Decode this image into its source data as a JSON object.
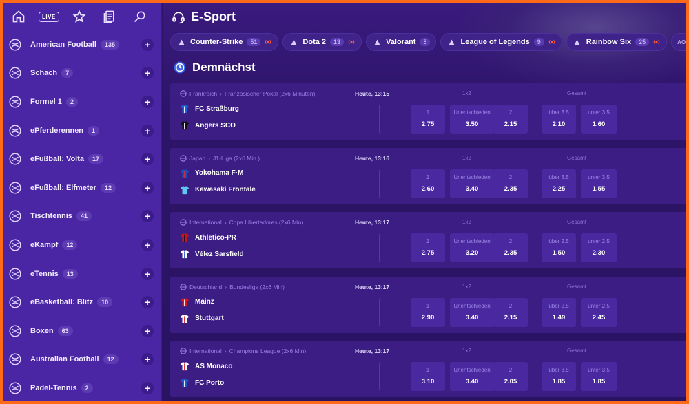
{
  "page_title": "E-Sport",
  "section_title": "Demnächst",
  "topbar": {
    "live_label": "LIVE"
  },
  "sidebar": {
    "items": [
      {
        "label": "American Football",
        "count": "135",
        "icon": "american-football-icon"
      },
      {
        "label": "Schach",
        "count": "7",
        "icon": "chess-knight-icon"
      },
      {
        "label": "Formel 1",
        "count": "2",
        "icon": "checkered-flag-icon"
      },
      {
        "label": "ePferderennen",
        "count": "1",
        "icon": "horse-racing-icon"
      },
      {
        "label": "eFußball: Volta",
        "count": "17",
        "icon": "soccer-ball-volta-icon"
      },
      {
        "label": "eFußball: Elfmeter",
        "count": "12",
        "icon": "soccer-ball-penalty-icon"
      },
      {
        "label": "Tischtennis",
        "count": "41",
        "icon": "table-tennis-icon"
      },
      {
        "label": "eKampf",
        "count": "12",
        "icon": "fist-icon"
      },
      {
        "label": "eTennis",
        "count": "13",
        "icon": "tennis-icon"
      },
      {
        "label": "eBasketball: Blitz",
        "count": "10",
        "icon": "basketball-blitz-icon"
      },
      {
        "label": "Boxen",
        "count": "63",
        "icon": "boxing-glove-icon"
      },
      {
        "label": "Australian Football",
        "count": "12",
        "icon": "australian-football-icon"
      },
      {
        "label": "Padel-Tennis",
        "count": "2",
        "icon": "padel-icon"
      }
    ]
  },
  "chips": [
    {
      "label": "Counter-Strike",
      "count": "51",
      "live": true
    },
    {
      "label": "Dota 2",
      "count": "13",
      "live": true
    },
    {
      "label": "Valorant",
      "count": "8",
      "live": false
    },
    {
      "label": "League of Legends",
      "count": "9",
      "live": true
    },
    {
      "label": "Rainbow Six",
      "count": "25",
      "live": true
    },
    {
      "label": "Arena of Valor",
      "count": "",
      "live": false,
      "prefix": "AOV"
    }
  ],
  "matches": [
    {
      "country": "Frankreich",
      "league": "Französischer Pokal (2x6 Minuten)",
      "time": "Heute, 13:15",
      "home": "FC Straßburg",
      "away": "Angers SCO",
      "market1": "1x2",
      "market2": "Gesamt",
      "odds": [
        {
          "label": "1",
          "value": "2.75"
        },
        {
          "label": "Unentschieden",
          "value": "3.50"
        },
        {
          "label": "2",
          "value": "2.15"
        },
        {
          "label": "über 3.5",
          "value": "2.10"
        },
        {
          "label": "unter 3.5",
          "value": "1.60"
        }
      ],
      "home_colors": [
        "#1e5bd6",
        "#ffffff"
      ],
      "away_colors": [
        "#111111",
        "#ffffff"
      ]
    },
    {
      "country": "Japan",
      "league": "J1-Liga (2x6 Min.)",
      "time": "Heute, 13:16",
      "home": "Yokohama F·M",
      "away": "Kawasaki Frontale",
      "market1": "1x2",
      "market2": "Gesamt",
      "odds": [
        {
          "label": "1",
          "value": "2.60"
        },
        {
          "label": "Unentschieden",
          "value": "3.40"
        },
        {
          "label": "2",
          "value": "2.35"
        },
        {
          "label": "über 3.5",
          "value": "2.25"
        },
        {
          "label": "unter 3.5",
          "value": "1.55"
        }
      ],
      "home_colors": [
        "#1d4fc4",
        "#e02b2b"
      ],
      "away_colors": [
        "#5fc8f0",
        "#5fc8f0"
      ]
    },
    {
      "country": "International",
      "league": "Copa Libertadores (2x6 Min)",
      "time": "Heute, 13:17",
      "home": "Athletico-PR",
      "away": "Vélez Sarsfield",
      "market1": "1x2",
      "market2": "Gesamt",
      "odds": [
        {
          "label": "1",
          "value": "2.75"
        },
        {
          "label": "Unentschieden",
          "value": "3.20"
        },
        {
          "label": "2",
          "value": "2.35"
        },
        {
          "label": "über 2.5",
          "value": "1.50"
        },
        {
          "label": "unter 2.5",
          "value": "2.30"
        }
      ],
      "home_colors": [
        "#c4161c",
        "#111111"
      ],
      "away_colors": [
        "#ffffff",
        "#1e56c8"
      ]
    },
    {
      "country": "Deutschland",
      "league": "Bundesliga (2x6 Min)",
      "time": "Heute, 13:17",
      "home": "Mainz",
      "away": "Stuttgart",
      "market1": "1x2",
      "market2": "Gesamt",
      "odds": [
        {
          "label": "1",
          "value": "2.90"
        },
        {
          "label": "Unentschieden",
          "value": "3.40"
        },
        {
          "label": "2",
          "value": "2.15"
        },
        {
          "label": "über 2.5",
          "value": "1.49"
        },
        {
          "label": "unter 2.5",
          "value": "2.45"
        }
      ],
      "home_colors": [
        "#d8141e",
        "#ffffff"
      ],
      "away_colors": [
        "#ffffff",
        "#d8141e"
      ]
    },
    {
      "country": "International",
      "league": "Champions League (2x6 Min)",
      "time": "Heute, 13:17",
      "home": "AS Monaco",
      "away": "FC Porto",
      "market1": "1x2",
      "market2": "Gesamt",
      "odds": [
        {
          "label": "1",
          "value": "3.10"
        },
        {
          "label": "Unentschieden",
          "value": "3.40"
        },
        {
          "label": "2",
          "value": "2.05"
        },
        {
          "label": "über 3.5",
          "value": "1.85"
        },
        {
          "label": "unter 3.5",
          "value": "1.85"
        }
      ],
      "home_colors": [
        "#ffffff",
        "#d8141e"
      ],
      "away_colors": [
        "#1e56c8",
        "#ffffff"
      ]
    }
  ],
  "colors": {
    "frame": "#ff6a1a",
    "sidebar": "#4a25a4",
    "main_bg": "#2c1468",
    "card": "#3c1d84",
    "odds_box": "#4a29a0",
    "league_text": "#9a7ee8",
    "live_indicator": "#ff5a3c"
  }
}
